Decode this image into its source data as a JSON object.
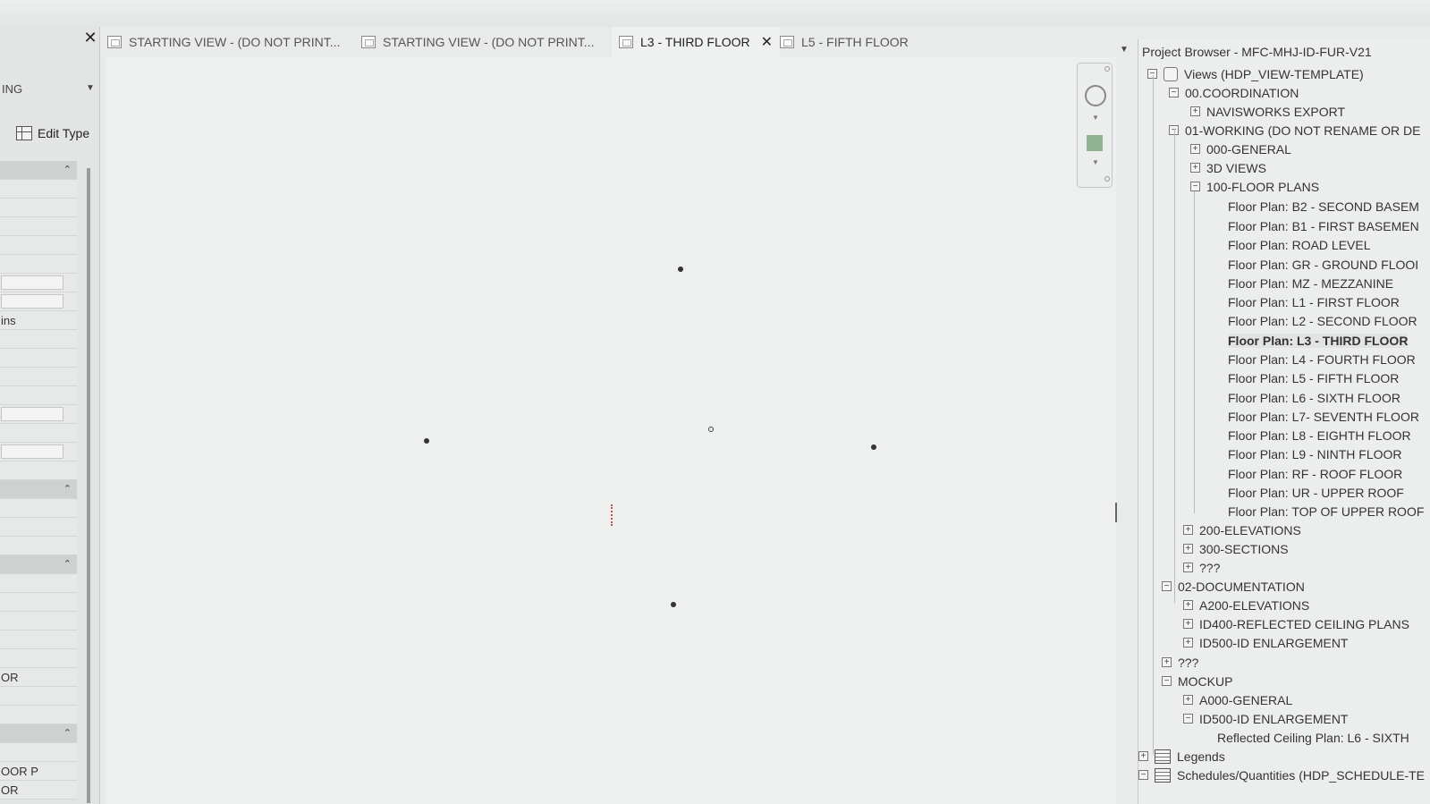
{
  "tabs": [
    {
      "label": "STARTING VIEW - (DO NOT PRINT...",
      "active": false
    },
    {
      "label": "STARTING VIEW - (DO NOT PRINT...",
      "active": false
    },
    {
      "label": "L3 - THIRD FLOOR",
      "active": true
    },
    {
      "label": "L5 - FIFTH FLOOR",
      "active": false
    }
  ],
  "left_panel": {
    "type_selector": "ING",
    "edit_type_label": "Edit Type",
    "rows": [
      "",
      "",
      "",
      "",
      "",
      "",
      "",
      "",
      "ins",
      "",
      "",
      "",
      "",
      "",
      "",
      "",
      "",
      "",
      "",
      "",
      "",
      "",
      "",
      "",
      "",
      "",
      "",
      "OR",
      "",
      "",
      "",
      "",
      "OOR P",
      "OR"
    ]
  },
  "browser": {
    "title": "Project Browser - MFC-MHJ-ID-FUR-V21",
    "tree": [
      {
        "label": "Views (HDP_VIEW-TEMPLATE)",
        "toggle": "−",
        "icon": "views"
      },
      {
        "label": "00.COORDINATION",
        "toggle": "−"
      },
      {
        "label": "NAVISWORKS EXPORT",
        "toggle": "+"
      },
      {
        "label": "01-WORKING (DO NOT RENAME OR DE",
        "toggle": "−"
      },
      {
        "label": "000-GENERAL",
        "toggle": "+"
      },
      {
        "label": "3D VIEWS",
        "toggle": "+"
      },
      {
        "label": "100-FLOOR PLANS",
        "toggle": "−"
      },
      {
        "label": "Floor Plan: B2 - SECOND BASEM",
        "toggle": ""
      },
      {
        "label": "Floor Plan: B1 - FIRST BASEMEN",
        "toggle": ""
      },
      {
        "label": "Floor Plan: ROAD LEVEL",
        "toggle": ""
      },
      {
        "label": "Floor Plan: GR - GROUND FLOOI",
        "toggle": ""
      },
      {
        "label": "Floor Plan: MZ - MEZZANINE",
        "toggle": ""
      },
      {
        "label": "Floor Plan: L1 - FIRST FLOOR",
        "toggle": ""
      },
      {
        "label": "Floor Plan: L2 - SECOND FLOOR",
        "toggle": ""
      },
      {
        "label": "Floor Plan: L3 - THIRD FLOOR",
        "toggle": "",
        "selected": true
      },
      {
        "label": "Floor Plan: L4 - FOURTH FLOOR",
        "toggle": ""
      },
      {
        "label": "Floor Plan: L5 - FIFTH FLOOR",
        "toggle": ""
      },
      {
        "label": "Floor Plan: L6 - SIXTH FLOOR",
        "toggle": ""
      },
      {
        "label": "Floor Plan: L7- SEVENTH FLOOR",
        "toggle": ""
      },
      {
        "label": "Floor Plan: L8 - EIGHTH FLOOR",
        "toggle": ""
      },
      {
        "label": "Floor Plan: L9 - NINTH FLOOR",
        "toggle": ""
      },
      {
        "label": "Floor Plan: RF - ROOF FLOOR",
        "toggle": ""
      },
      {
        "label": "Floor Plan: UR - UPPER ROOF",
        "toggle": ""
      },
      {
        "label": "Floor Plan: TOP OF UPPER ROOF",
        "toggle": ""
      },
      {
        "label": "200-ELEVATIONS",
        "toggle": "+"
      },
      {
        "label": "300-SECTIONS",
        "toggle": "+"
      },
      {
        "label": "???",
        "toggle": "+"
      },
      {
        "label": "02-DOCUMENTATION",
        "toggle": "−"
      },
      {
        "label": "A200-ELEVATIONS",
        "toggle": "+"
      },
      {
        "label": "ID400-REFLECTED CEILING PLANS",
        "toggle": "+"
      },
      {
        "label": "ID500-ID ENLARGEMENT",
        "toggle": "+"
      },
      {
        "label": "???",
        "toggle": "+"
      },
      {
        "label": "MOCKUP",
        "toggle": "−"
      },
      {
        "label": "A000-GENERAL",
        "toggle": "+"
      },
      {
        "label": "ID500-ID ENLARGEMENT",
        "toggle": "−"
      },
      {
        "label": "Reflected Ceiling Plan: L6 - SIXTH",
        "toggle": ""
      },
      {
        "label": "Legends",
        "toggle": "+",
        "icon": "table"
      },
      {
        "label": "Schedules/Quantities (HDP_SCHEDULE-TE",
        "toggle": "−",
        "icon": "table"
      }
    ]
  }
}
